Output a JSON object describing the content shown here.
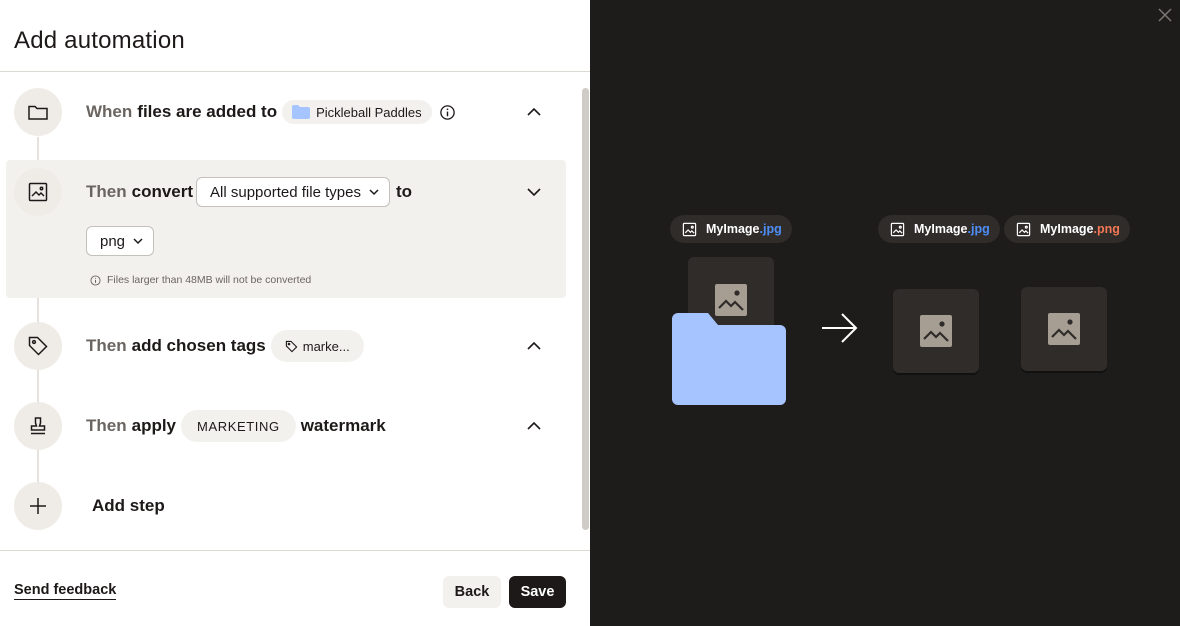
{
  "header": {
    "title": "Add automation"
  },
  "steps": {
    "trigger": {
      "lead": "When",
      "text": "files are added to",
      "folder_name": "Pickleball Paddles"
    },
    "convert": {
      "lead": "Then",
      "text": "convert",
      "source_select": "All supported file types",
      "to_word": "to",
      "target_select": "png",
      "note": "Files larger than 48MB will not be converted"
    },
    "tags": {
      "lead": "Then",
      "text": "add chosen tags",
      "tag_value": "marke..."
    },
    "watermark": {
      "lead": "Then",
      "text": "apply",
      "watermark_value": "MARKETING",
      "suffix": "watermark"
    },
    "add_step_label": "Add step"
  },
  "footer": {
    "feedback_link": "Send feedback",
    "back_label": "Back",
    "save_label": "Save"
  },
  "preview": {
    "source_file": {
      "name": "MyImage",
      "ext": ".jpg"
    },
    "output_original": {
      "name": "MyImage",
      "ext": ".jpg"
    },
    "output_converted": {
      "name": "MyImage",
      "ext": ".png"
    },
    "colors": {
      "jpg_ext": "#4f8ef7",
      "png_ext": "#f27855",
      "folder": "#a6c4ff",
      "background": "#1e1c1b"
    }
  },
  "icons": [
    "folder-icon",
    "image-icon",
    "tag-icon",
    "stamp-icon",
    "plus-icon",
    "info-icon",
    "chevron-up-icon",
    "chevron-down-icon",
    "close-icon",
    "arrow-right-icon"
  ]
}
